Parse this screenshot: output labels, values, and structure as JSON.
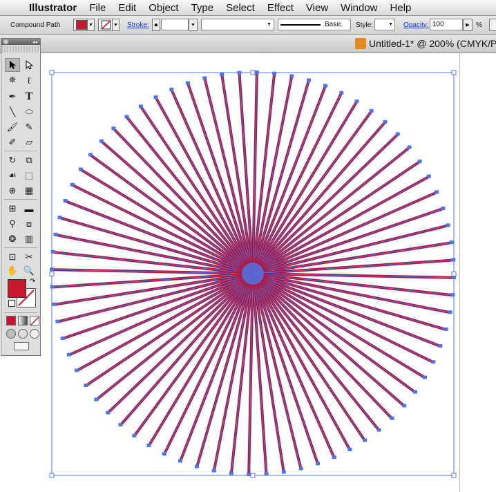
{
  "menubar": {
    "apple_glyph": "",
    "app_name": "Illustrator",
    "items": [
      "File",
      "Edit",
      "Object",
      "Type",
      "Select",
      "Effect",
      "View",
      "Window",
      "Help"
    ]
  },
  "control": {
    "selection_type": "Compound Path",
    "stroke_label": "Stroke:",
    "brush_label": "Basic",
    "style_label": "Style:",
    "opacity_label": "Opacity:",
    "opacity_value": "100",
    "percent": "%"
  },
  "document": {
    "title": "Untitled-1* @ 200% (CMYK/P"
  },
  "colors": {
    "fill": "#c8182f",
    "ray": "#b0163a",
    "selection": "#4f74e8"
  },
  "art": {
    "ray_count": 72
  }
}
